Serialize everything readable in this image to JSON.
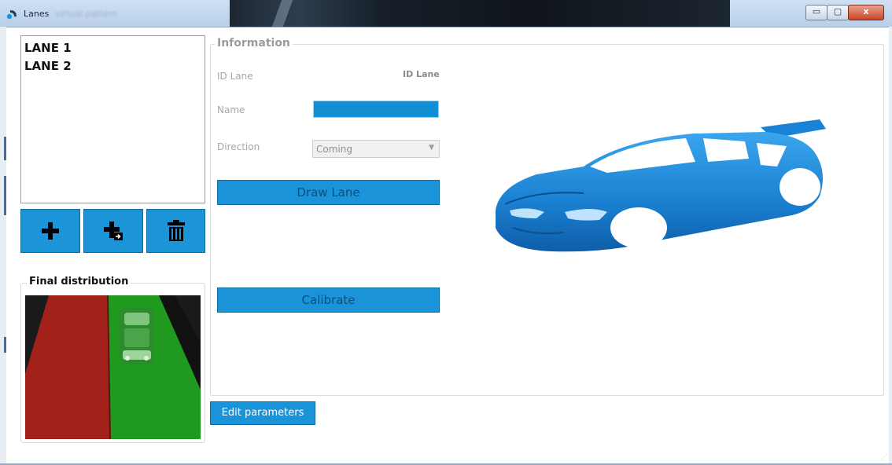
{
  "window": {
    "title": "Lanes",
    "subtitle_blurred": "virtual pattern",
    "minimize_glyph": "▭",
    "maximize_glyph": "▢",
    "close_glyph": "x"
  },
  "lanes": {
    "items": [
      "LANE 1",
      "LANE 2"
    ],
    "buttons": [
      {
        "name": "add-lane-button",
        "icon": "plus-icon"
      },
      {
        "name": "add-from-button",
        "icon": "plus-arrow-icon"
      },
      {
        "name": "delete-lane-button",
        "icon": "trash-icon"
      }
    ]
  },
  "final_distribution": {
    "label": "Final distribution"
  },
  "information": {
    "label": "Information",
    "id_label": "ID Lane",
    "id_value": "ID Lane",
    "name_label": "Name",
    "name_value": "",
    "direction_label": "Direction",
    "direction_value": "Coming",
    "draw_lane_label": "Draw Lane",
    "calibrate_label": "Calibrate"
  },
  "footer": {
    "edit_parameters_label": "Edit parameters"
  },
  "colors": {
    "accent": "#1a93d9",
    "lane_red": "#a3211b",
    "lane_green": "#1f9a1f",
    "car_blue": "#1f8fe0"
  }
}
